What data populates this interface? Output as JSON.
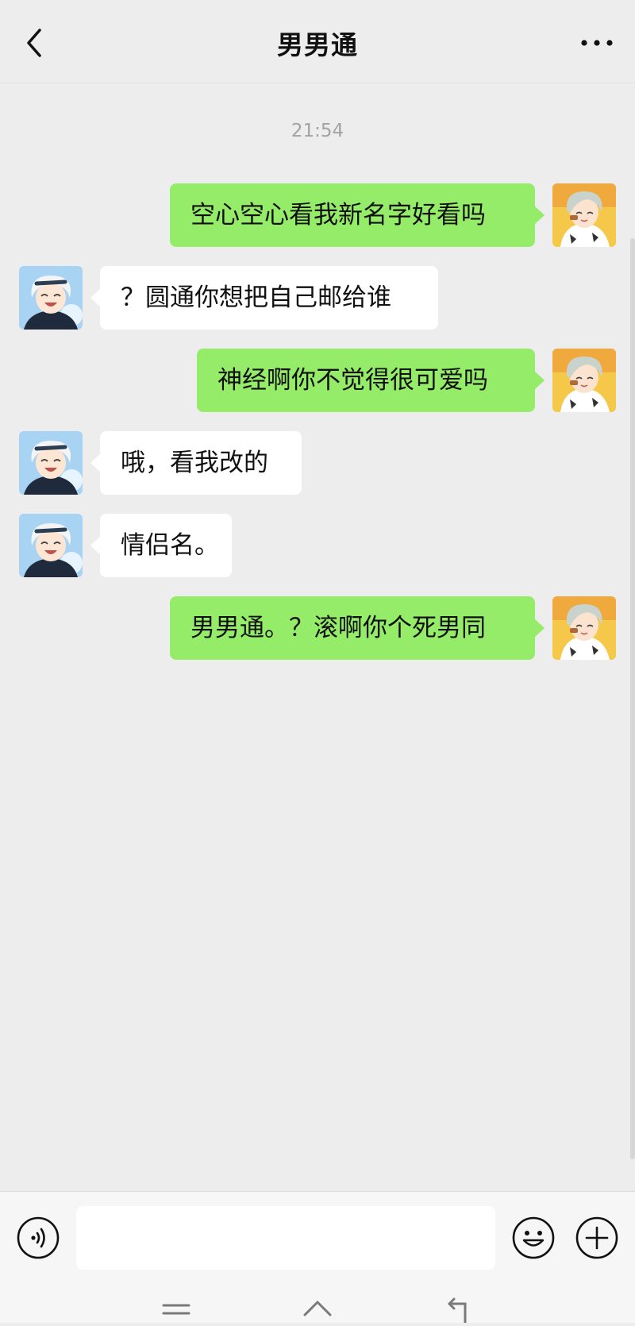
{
  "header": {
    "title": "男男通",
    "back_icon": "chevron-left-icon",
    "more_icon": "more-horizontal-icon"
  },
  "chat": {
    "timestamp": "21:54",
    "messages": [
      {
        "side": "out",
        "text": "空心空心看我新名字好看吗"
      },
      {
        "side": "in",
        "text": "？圆通你想把自己邮给谁"
      },
      {
        "side": "out",
        "text": "神经啊你不觉得很可爱吗"
      },
      {
        "side": "in",
        "text": "哦，看我改的"
      },
      {
        "side": "in",
        "text": "情侣名。"
      },
      {
        "side": "out",
        "text": "男男通。？滚啊你个死男同"
      }
    ]
  },
  "input_bar": {
    "value": "",
    "voice_icon": "voice-icon",
    "emoji_icon": "emoji-icon",
    "plus_icon": "plus-icon"
  },
  "nav": {
    "menu_icon": "menu-icon",
    "home_icon": "home-icon",
    "back_icon": "back-icon"
  },
  "colors": {
    "background": "#ededed",
    "outgoing_bubble": "#95ec69",
    "incoming_bubble": "#ffffff",
    "timestamp": "#a3a3a3"
  }
}
